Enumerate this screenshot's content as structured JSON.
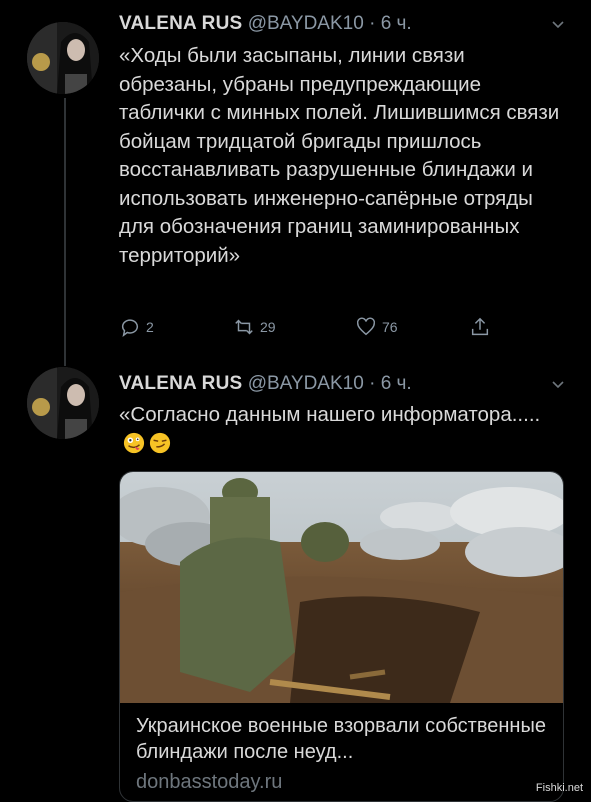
{
  "tweets": [
    {
      "name": "VALENA RUS",
      "handle": "@BAYDAK10",
      "dot": "·",
      "time": "6 ч.",
      "text": "«Ходы были засыпаны, линии связи обрезаны, убраны предупреждающие таблички с минных полей. Лишившимся связи бойцам тридцатой бригады пришлось восстанавливать разрушенные блиндажи и использовать инженерно-сапёрные отряды для обозначения границ заминированных территорий»",
      "reply_count": "2",
      "retweet_count": "29",
      "like_count": "76"
    },
    {
      "name": "VALENA RUS",
      "handle": "@BAYDAK10",
      "dot": "·",
      "time": "6 ч.",
      "text": "«Согласно данным нашего информатора.....",
      "emojis": [
        "zany-face",
        "smirking-face"
      ],
      "card": {
        "title": "Украинское военные взорвали собственные блиндажи после неуд...",
        "domain": "donbasstoday.ru"
      }
    }
  ],
  "watermark": "Fishki.net",
  "colors": {
    "background": "#000000",
    "text": "#d9d9d9",
    "muted": "#8b98a5",
    "border": "#2f3336"
  }
}
